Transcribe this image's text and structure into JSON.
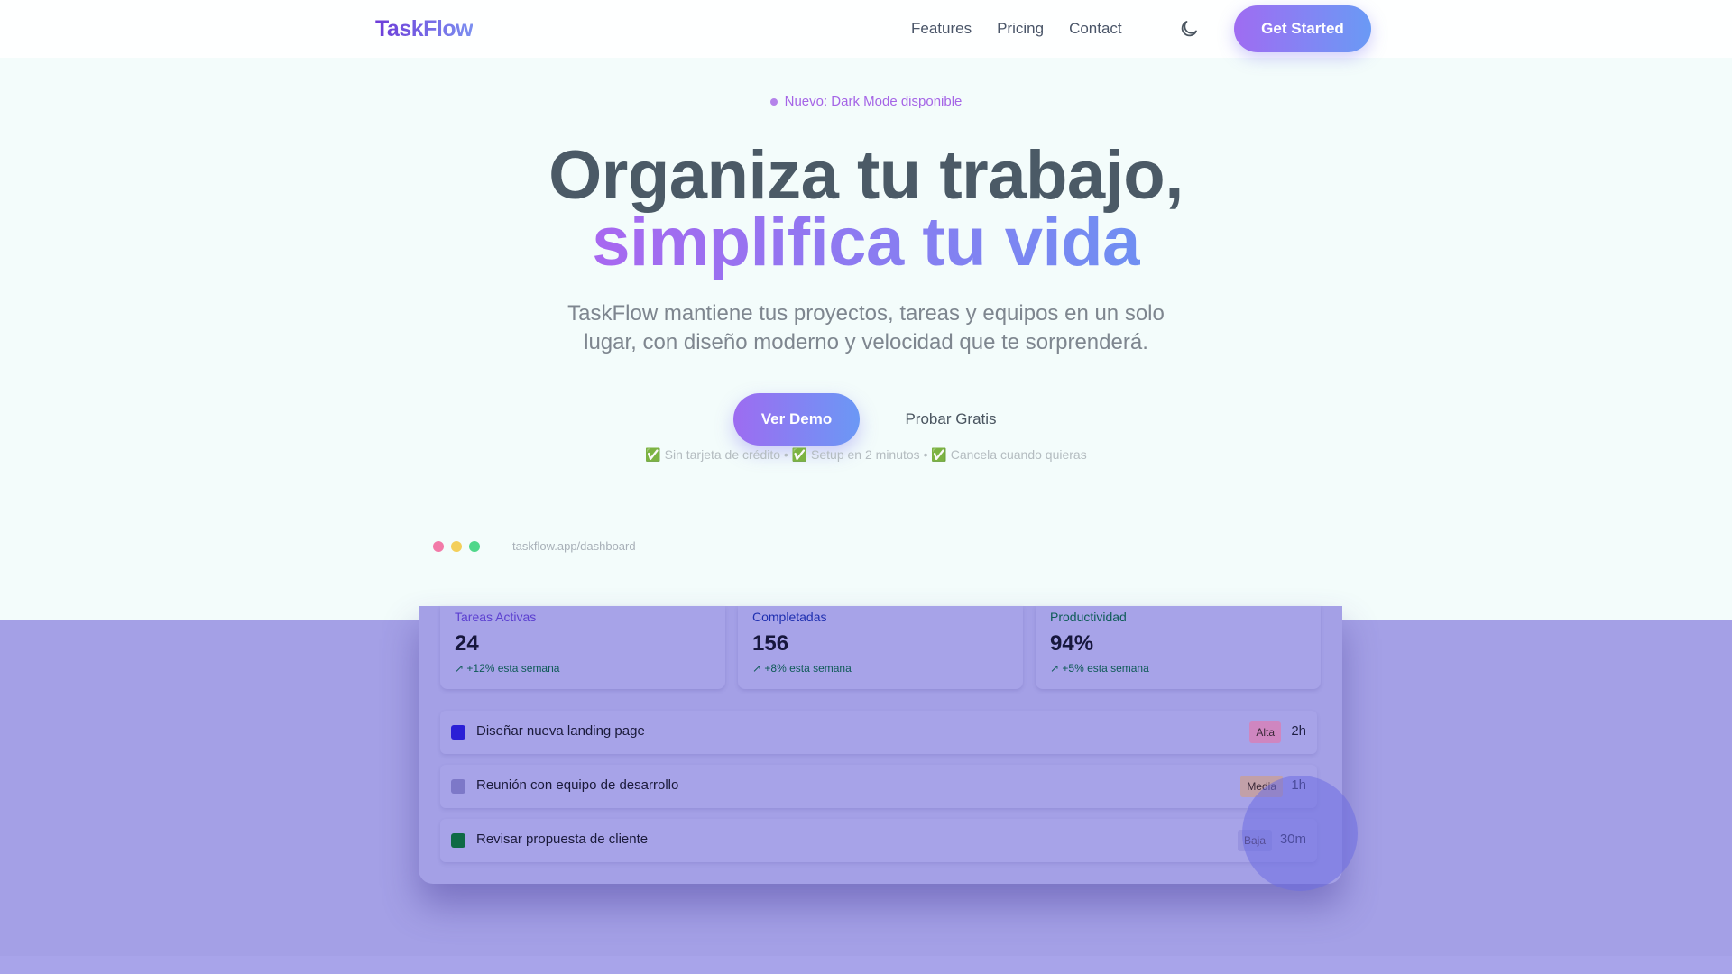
{
  "nav": {
    "logo": "TaskFlow",
    "links": [
      "Features",
      "Pricing",
      "Contact"
    ],
    "theme_icon": "moon-icon",
    "cta_label": "Get Started"
  },
  "hero": {
    "badge": "Nuevo: Dark Mode disponible",
    "title_line1": "Organiza tu trabajo,",
    "title_line2": "simplifica tu vida",
    "subtitle": "TaskFlow mantiene tus proyectos, tareas y equipos en un solo lugar, con diseño moderno y velocidad que te sorprenderá.",
    "primary_cta": "Ver Demo",
    "secondary_cta": "Probar Gratis",
    "guarantees": [
      "Sin tarjeta de crédito",
      "Setup en 2 minutos",
      "Cancela cuando quieras"
    ]
  },
  "preview": {
    "url": "taskflow.app/dashboard",
    "window_dot_colors": [
      "#f27aa8",
      "#f3cf5a",
      "#4fd78a"
    ],
    "stats": [
      {
        "label": "Tareas Activas",
        "value": "24",
        "change": "↗ +12% esta semana",
        "color": "#5b3fd0"
      },
      {
        "label": "Completadas",
        "value": "156",
        "change": "↗ +8% esta semana",
        "color": "#1f2fb0"
      },
      {
        "label": "Productividad",
        "value": "94%",
        "change": "↗ +5% esta semana",
        "color": "#0e5c57"
      }
    ],
    "tasks": [
      {
        "title": "Diseñar nueva landing page",
        "priority": "Alta",
        "time": "2h",
        "check_color": "#2a1fd6",
        "priority_color": "#cf86c0"
      },
      {
        "title": "Reunión con equipo de desarrollo",
        "priority": "Media",
        "time": "1h",
        "check_color": "#7d78c8",
        "priority_color": "#c2a0a8"
      },
      {
        "title": "Revisar propuesta de cliente",
        "priority": "Baja",
        "time": "30m",
        "check_color": "#0f6a45",
        "priority_color": "#9894e0"
      }
    ]
  }
}
